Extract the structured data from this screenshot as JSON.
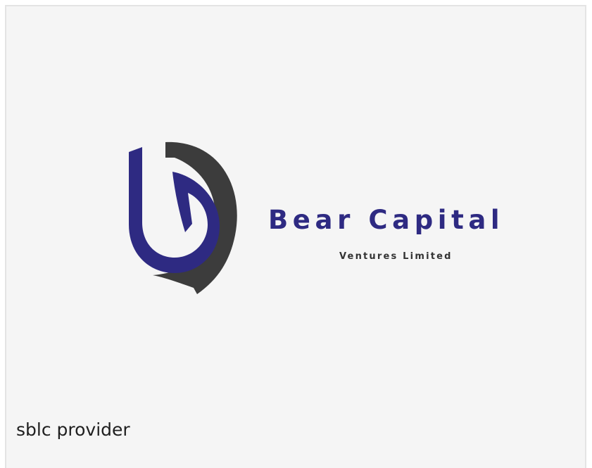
{
  "logo": {
    "title": "Bear Capital",
    "subtitle": "Ventures Limited",
    "colors": {
      "primary": "#2e2a82",
      "dark": "#3c3c3c"
    }
  },
  "caption": "sblc provider",
  "colors": {
    "background": "#f5f5f5",
    "border": "#e4e4e4",
    "text": "#1f1f1f"
  }
}
